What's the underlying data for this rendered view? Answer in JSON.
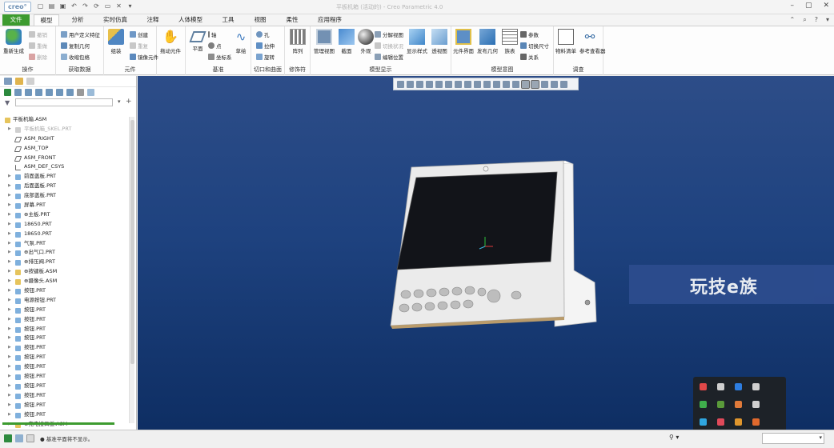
{
  "app": {
    "logo": "creo°",
    "title": "平板机箱 (活动的) - Creo Parametric 4.0"
  },
  "tabs": [
    "文件",
    "模型",
    "分析",
    "实时仿真",
    "注释",
    "人体模型",
    "工具",
    "视图",
    "柔性",
    "应用程序"
  ],
  "active_tab": "模型",
  "ribbon": {
    "groups": {
      "operations": "操作",
      "get_data": "获取数据",
      "elements": "元件",
      "datum": "基准",
      "cut_surface": "切口和曲面",
      "modifier": "修饰符",
      "model_display": "模型显示",
      "model_intent": "模型意图",
      "investigate": "调查"
    },
    "buttons": {
      "regenerate": "重新生成",
      "undo_ops": "撤销",
      "redo_ops": "重做",
      "delete": "删除",
      "user_def_feature": "用户定义特征",
      "copy_geometry": "复制几何",
      "shrinkwrap": "收缩包络",
      "assemble": "组装",
      "create": "创建",
      "repeat": "重复",
      "mirror_component": "镜像元件",
      "drag_components": "拖动元件",
      "plane": "平面",
      "axis": "轴",
      "point": "点",
      "coord_sys": "坐标系",
      "sketch": "草绘",
      "hole": "孔",
      "extrude": "拉伸",
      "revolve": "旋转",
      "pattern": "阵列",
      "manage_views": "管理视图",
      "section": "截面",
      "appearance": "外观",
      "explode_view": "分解视图",
      "toggle_status": "切换状况",
      "edit_position": "编辑位置",
      "display_style": "显示样式",
      "perspective": "透视图",
      "component_interface": "元件界面",
      "publish_geometry": "发布几何",
      "table": "族表",
      "parameters": "参数",
      "switch_dims": "切换尺寸",
      "relations": "关系",
      "bom": "物料清单",
      "reference_viewer": "参考查看器"
    }
  },
  "tree": {
    "root": "平板机箱.ASM",
    "items": [
      {
        "label": "平板机箱_SKEL.PRT",
        "kind": "skel",
        "dim": true
      },
      {
        "label": "ASM_RIGHT",
        "kind": "plane"
      },
      {
        "label": "ASM_TOP",
        "kind": "plane"
      },
      {
        "label": "ASM_FRONT",
        "kind": "plane"
      },
      {
        "label": "ASM_DEF_CSYS",
        "kind": "csys"
      },
      {
        "label": "前面盖板.PRT",
        "kind": "part"
      },
      {
        "label": "后面盖板.PRT",
        "kind": "part"
      },
      {
        "label": "底部盖板.PRT",
        "kind": "part"
      },
      {
        "label": "屏幕.PRT",
        "kind": "part"
      },
      {
        "label": "⊕主板.PRT",
        "kind": "part"
      },
      {
        "label": "18650.PRT",
        "kind": "part"
      },
      {
        "label": "18650.PRT",
        "kind": "part"
      },
      {
        "label": "气泵.PRT",
        "kind": "part"
      },
      {
        "label": "⊕出气口.PRT",
        "kind": "part"
      },
      {
        "label": "⊕排压阀.PRT",
        "kind": "part"
      },
      {
        "label": "⊕按键板.ASM",
        "kind": "asm"
      },
      {
        "label": "⊕摄像头.ASM",
        "kind": "asm"
      },
      {
        "label": "按钮.PRT",
        "kind": "part"
      },
      {
        "label": "电源按钮.PRT",
        "kind": "part"
      },
      {
        "label": "按钮.PRT",
        "kind": "part"
      },
      {
        "label": "按钮.PRT",
        "kind": "part"
      },
      {
        "label": "按钮.PRT",
        "kind": "part"
      },
      {
        "label": "按钮.PRT",
        "kind": "part"
      },
      {
        "label": "按钮.PRT",
        "kind": "part"
      },
      {
        "label": "按钮.PRT",
        "kind": "part"
      },
      {
        "label": "按钮.PRT",
        "kind": "part"
      },
      {
        "label": "按钮.PRT",
        "kind": "part"
      },
      {
        "label": "按钮.PRT",
        "kind": "part"
      },
      {
        "label": "按钮.PRT",
        "kind": "part"
      },
      {
        "label": "按钮.PRT",
        "kind": "part"
      },
      {
        "label": "按钮.PRT",
        "kind": "part"
      },
      {
        "label": "⊕充电接口板.ASM",
        "kind": "asm"
      }
    ]
  },
  "watermark": "玩技e族",
  "status": {
    "message": "● 基准平面将不显示。"
  },
  "colors": {
    "file_tab": "#3d9b2f",
    "viewport_top": "#2d4d88",
    "viewport_bottom": "#0e2e63",
    "screen": "#121419",
    "body": "#ebebeb"
  }
}
